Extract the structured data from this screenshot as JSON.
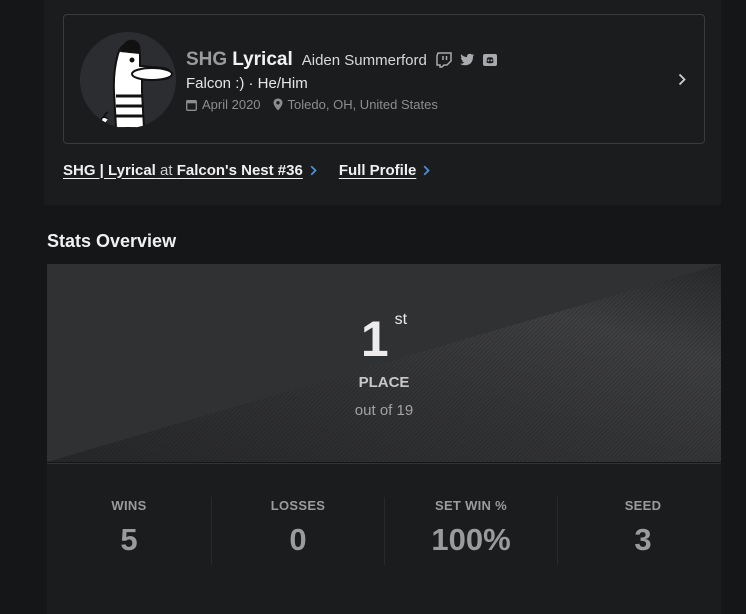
{
  "profile": {
    "prefix": "SHG",
    "gamertag": "Lyrical",
    "real_name": "Aiden Summerford",
    "bio": "Falcon :) · He/Him",
    "joined": "April 2020",
    "location": "Toledo, OH, United States",
    "social_icons": [
      "twitch-icon",
      "twitter-icon",
      "discord-icon"
    ]
  },
  "links": {
    "entrant_name": "SHG | Lyrical",
    "at_word": "at",
    "event_name": "Falcon's Nest #36",
    "full_profile": "Full Profile"
  },
  "stats_overview": {
    "title": "Stats Overview",
    "placement": "1",
    "placement_suffix": "st",
    "placement_label": "PLACE",
    "out_of": "out of 19"
  },
  "stats": [
    {
      "label": "WINS",
      "value": "5"
    },
    {
      "label": "LOSSES",
      "value": "0"
    },
    {
      "label": "SET WIN %",
      "value": "100%"
    },
    {
      "label": "SEED",
      "value": "3"
    }
  ],
  "colors": {
    "page_bg": "#151618",
    "panel_bg": "#1b1c1e",
    "accent_link": "#4a90d9",
    "muted": "#9a9b9d"
  }
}
